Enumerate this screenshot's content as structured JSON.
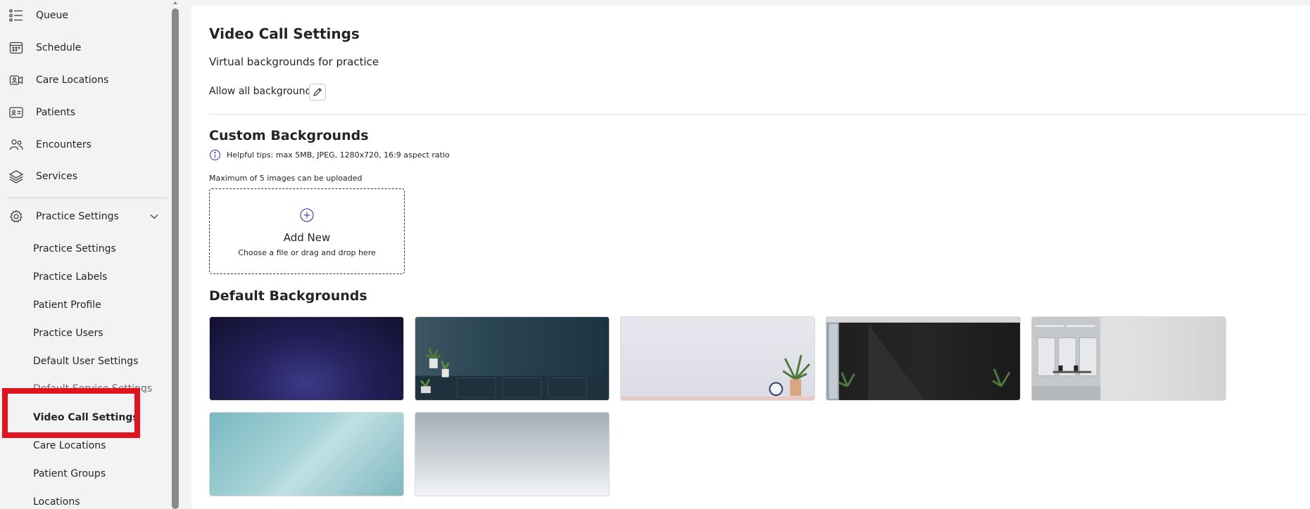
{
  "sidebar": {
    "nav": [
      {
        "label": "Queue",
        "icon": "list-icon"
      },
      {
        "label": "Schedule",
        "icon": "calendar-icon"
      },
      {
        "label": "Care Locations",
        "icon": "video-camera-icon"
      },
      {
        "label": "Patients",
        "icon": "id-card-icon"
      },
      {
        "label": "Encounters",
        "icon": "people-icon"
      },
      {
        "label": "Services",
        "icon": "layers-icon"
      }
    ],
    "practice_settings": {
      "label": "Practice Settings",
      "icon": "gear-icon",
      "expanded": true
    },
    "sub_items": [
      {
        "label": "Practice Settings"
      },
      {
        "label": "Practice Labels"
      },
      {
        "label": "Patient Profile"
      },
      {
        "label": "Practice Users"
      },
      {
        "label": "Default User Settings"
      },
      {
        "label": "Default Service Settings"
      },
      {
        "label": "Video Call Settings",
        "active": true
      },
      {
        "label": "Care Locations"
      },
      {
        "label": "Patient Groups"
      },
      {
        "label": "Locations"
      }
    ]
  },
  "main": {
    "title": "Video Call Settings",
    "subtitle": "Virtual backgrounds for practice",
    "allow_label": "Allow all backgrounds",
    "custom": {
      "heading": "Custom Backgrounds",
      "tip": "Helpful tips: max 5MB, JPEG, 1280x720, 16:9 aspect ratio",
      "max_note": "Maximum of 5 images can be uploaded",
      "add_label": "Add New",
      "add_hint": "Choose a file or drag and drop here"
    },
    "default": {
      "heading": "Default Backgrounds"
    }
  },
  "colors": {
    "highlight": "#e0141e",
    "accent": "#4f52b2",
    "background": "#f3f3f3"
  }
}
